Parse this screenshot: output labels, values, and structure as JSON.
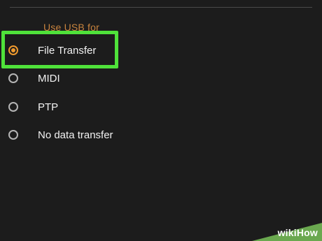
{
  "section": {
    "label": "Use USB for"
  },
  "options": [
    {
      "label": "File Transfer",
      "selected": true
    },
    {
      "label": "MIDI",
      "selected": false
    },
    {
      "label": "PTP",
      "selected": false
    },
    {
      "label": "No data transfer",
      "selected": false
    }
  ],
  "watermark": {
    "text": "wikiHow"
  },
  "colors": {
    "background": "#1c1c1c",
    "accent": "#ef9a2e",
    "section_label": "#c8843e",
    "highlight": "#4fe23a",
    "text": "#f2f2f2"
  },
  "icons": {
    "selected": "radio-checked-icon",
    "unselected": "radio-unchecked-icon"
  }
}
